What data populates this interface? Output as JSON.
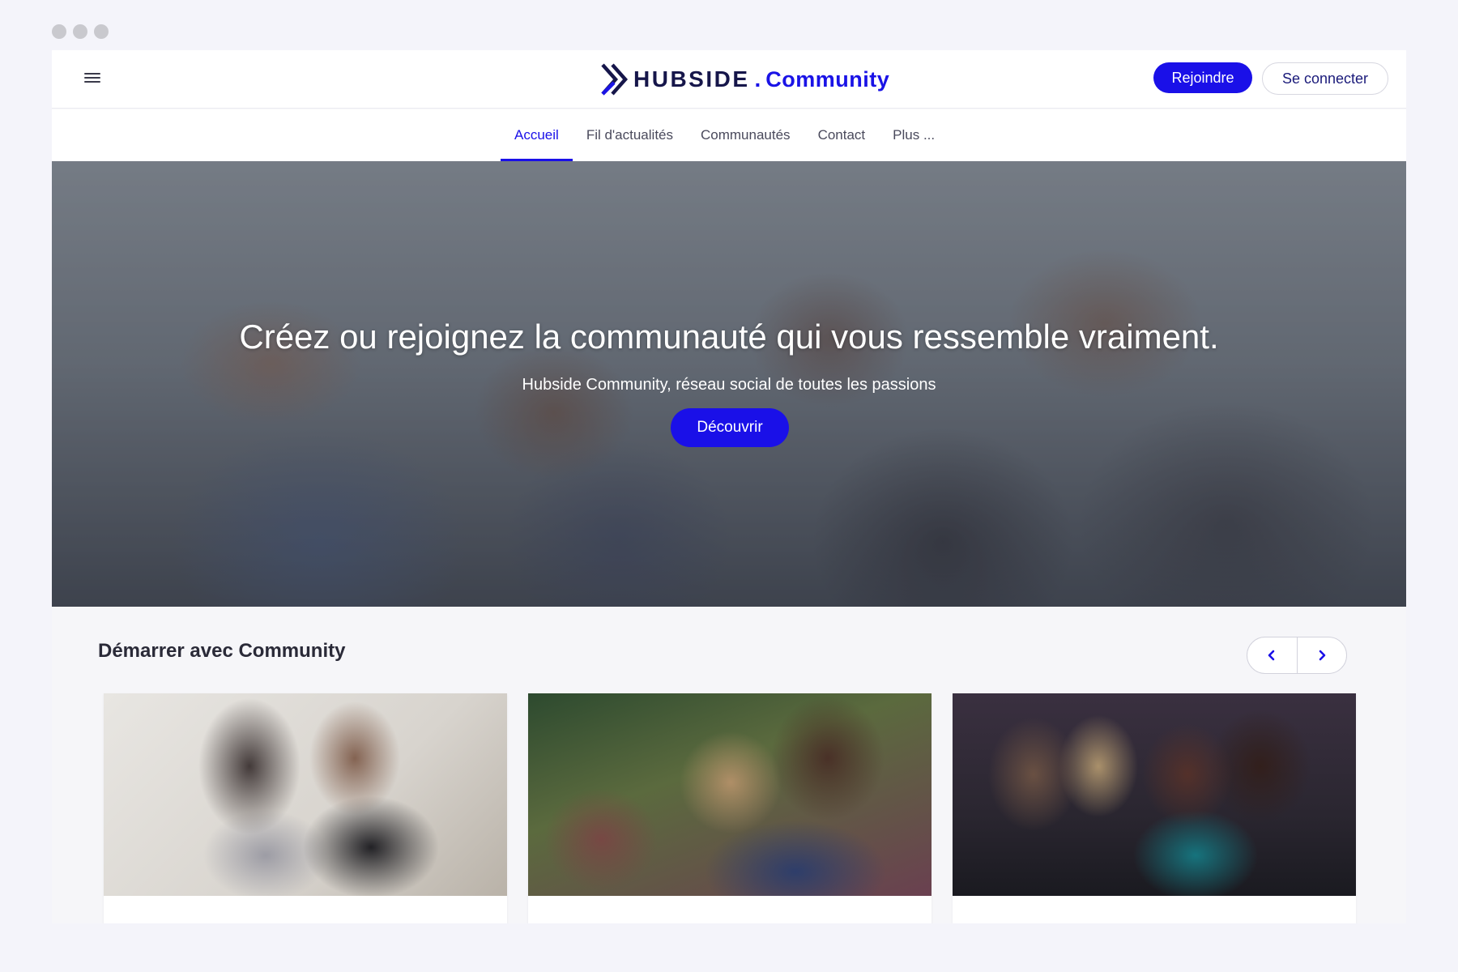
{
  "window": {
    "dots": [
      "",
      "",
      ""
    ]
  },
  "header": {
    "menu_icon": "hamburger-icon",
    "brand": {
      "name": "HUBSIDE",
      "dot": ".",
      "suffix": "Community"
    },
    "join_label": "Rejoindre",
    "login_label": "Se connecter"
  },
  "nav": {
    "items": [
      {
        "label": "Accueil",
        "active": true
      },
      {
        "label": "Fil d'actualités",
        "active": false
      },
      {
        "label": "Communautés",
        "active": false
      },
      {
        "label": "Contact",
        "active": false
      },
      {
        "label": "Plus ...",
        "active": false
      }
    ]
  },
  "hero": {
    "title": "Créez ou rejoignez la communauté qui vous ressemble vraiment.",
    "subtitle": "Hubside Community, réseau social de toutes les passions",
    "cta_label": "Découvrir"
  },
  "section": {
    "title": "Démarrer avec Community",
    "prev_icon": "chevron-left-icon",
    "next_icon": "chevron-right-icon",
    "cards": [
      {
        "image": "two women at laptop"
      },
      {
        "image": "group of friends laughing"
      },
      {
        "image": "friends at festival"
      }
    ]
  },
  "colors": {
    "accent": "#1a10e8",
    "brand_dark": "#16164a",
    "page_bg": "#f4f4fa"
  }
}
